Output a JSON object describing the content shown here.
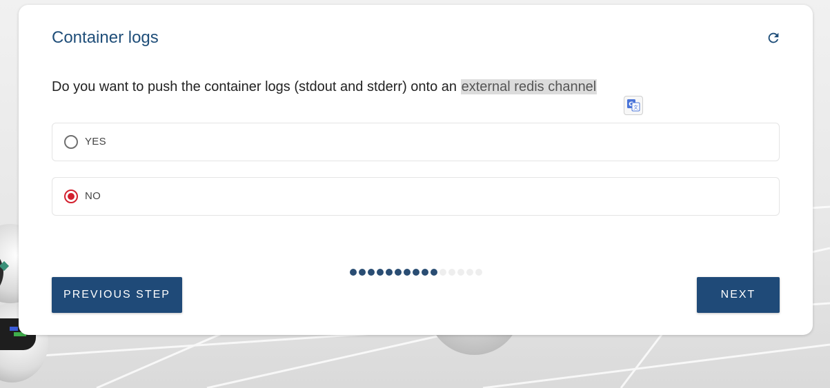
{
  "card": {
    "title": "Container logs",
    "refresh_icon": "refresh-icon"
  },
  "question": {
    "text_before": "Do you want to push the container logs (stdout and stderr) onto an ",
    "highlighted": "external redis channel",
    "translate_icon": "google-translate-icon"
  },
  "options": [
    {
      "label": "YES",
      "selected": false
    },
    {
      "label": "NO",
      "selected": true
    }
  ],
  "progress": {
    "completed_steps": 10,
    "total_steps": 15
  },
  "buttons": {
    "previous_label": "PREVIOUS STEP",
    "next_label": "NEXT"
  },
  "colors": {
    "accent": "#1f4a78",
    "title": "#1f4e79",
    "radio_selected": "#d3202e",
    "progress_done": "#2a4d73",
    "progress_pending": "#eeeeee"
  }
}
